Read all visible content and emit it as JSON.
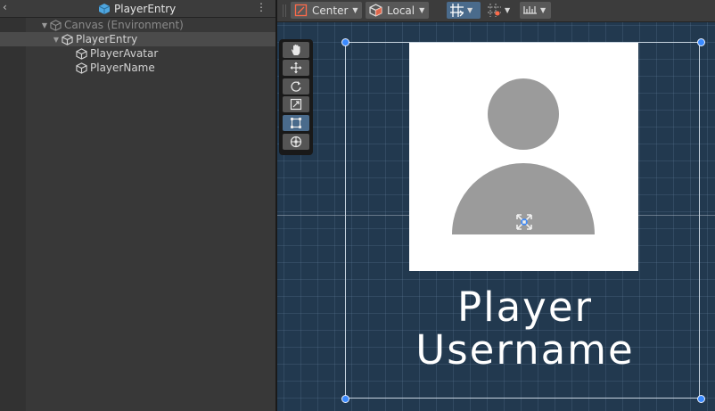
{
  "hierarchy": {
    "title": "PlayerEntry",
    "items": [
      {
        "label": "Canvas (Environment)",
        "depth": 1,
        "expanded": true,
        "dim": true
      },
      {
        "label": "PlayerEntry",
        "depth": 2,
        "expanded": true,
        "selected": true
      },
      {
        "label": "PlayerAvatar",
        "depth": 3
      },
      {
        "label": "PlayerName",
        "depth": 3
      }
    ]
  },
  "toolbar": {
    "pivot_mode": "Center",
    "pivot_rotation": "Local"
  },
  "scene": {
    "text_line1": "Player",
    "text_line2": "Username"
  },
  "tools": [
    "hand-tool",
    "move-tool",
    "rotate-tool",
    "scale-tool",
    "rect-tool",
    "transform-tool"
  ],
  "colors": {
    "accent": "#4a6b8c",
    "scene_bg": "#22394f",
    "silhouette": "#9b9b9b",
    "handle": "#3a8aff"
  }
}
